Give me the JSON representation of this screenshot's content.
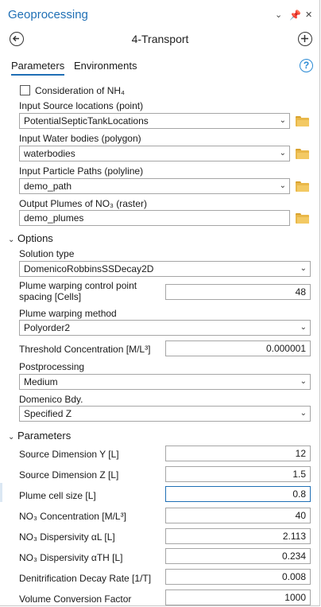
{
  "pane": {
    "title": "Geoprocessing",
    "tool_title": "4-Transport"
  },
  "window_controls": {
    "menu": "⌄",
    "pin": "✕",
    "close": "✕"
  },
  "tabs": {
    "parameters": "Parameters",
    "environments": "Environments"
  },
  "help_label": "?",
  "params": {
    "nh4_label": "Consideration of NH₄",
    "nh4_checked": false,
    "source_label": "Input Source locations (point)",
    "source_value": "PotentialSepticTankLocations",
    "water_label": "Input Water bodies (polygon)",
    "water_value": "waterbodies",
    "paths_label": "Input Particle Paths (polyline)",
    "paths_value": "demo_path",
    "plumes_label": "Output Plumes of NO₃ (raster)",
    "plumes_value": "demo_plumes"
  },
  "options": {
    "header": "Options",
    "solution_label": "Solution type",
    "solution_value": "DomenicoRobbinsSSDecay2D",
    "warp_spacing_label_1": "Plume warping control point",
    "warp_spacing_label_2": "spacing [Cells]",
    "warp_spacing_value": "48",
    "warp_method_label": "Plume warping method",
    "warp_method_value": "Polyorder2",
    "threshold_label": "Threshold Concentration [M/L³]",
    "threshold_value": "0.000001",
    "post_label": "Postprocessing",
    "post_value": "Medium",
    "bdy_label": "Domenico Bdy.",
    "bdy_value": "Specified Z"
  },
  "parameters": {
    "header": "Parameters",
    "src_y_label": "Source Dimension Y [L]",
    "src_y_value": "12",
    "src_z_label": "Source Dimension Z [L]",
    "src_z_value": "1.5",
    "cell_label": "Plume cell size [L]",
    "cell_value": "0.8",
    "no3_conc_label": "NO₃ Concentration [M/L³]",
    "no3_conc_value": "40",
    "disp_l_label": "NO₃ Dispersivity αL [L]",
    "disp_l_value": "2.113",
    "disp_th_label": "NO₃ Dispersivity αTH [L]",
    "disp_th_value": "0.234",
    "denit_label": "Denitrification Decay Rate [1/T]",
    "denit_value": "0.008",
    "vol_label": "Volume Conversion Factor",
    "vol_value": "1000"
  }
}
